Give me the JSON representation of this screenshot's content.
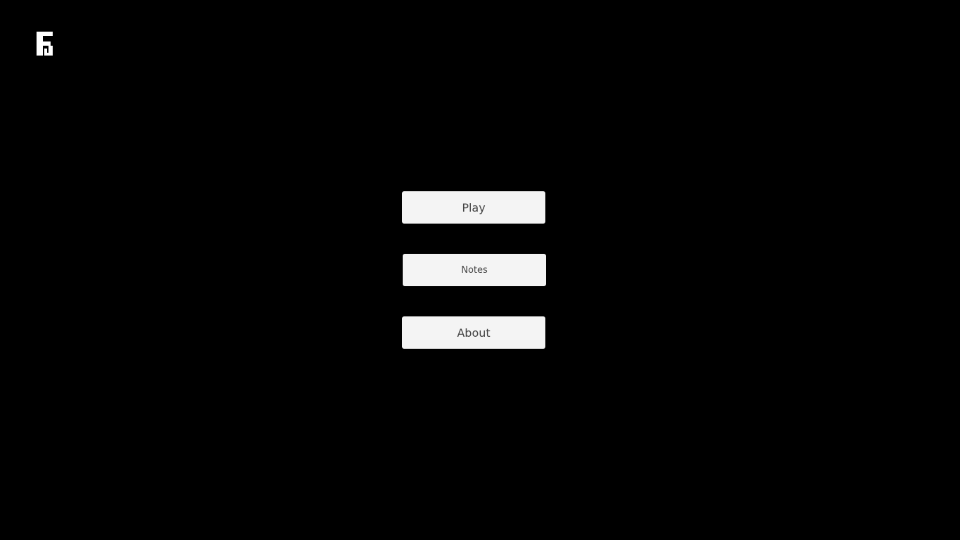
{
  "app": {
    "logo_icon": "studio-logo-icon"
  },
  "menu": {
    "play_label": "Play",
    "notes_label": "Notes",
    "about_label": "About"
  },
  "colors": {
    "background": "#000000",
    "button_bg": "#f4f4f4",
    "button_text": "#444444",
    "logo": "#ffffff"
  }
}
